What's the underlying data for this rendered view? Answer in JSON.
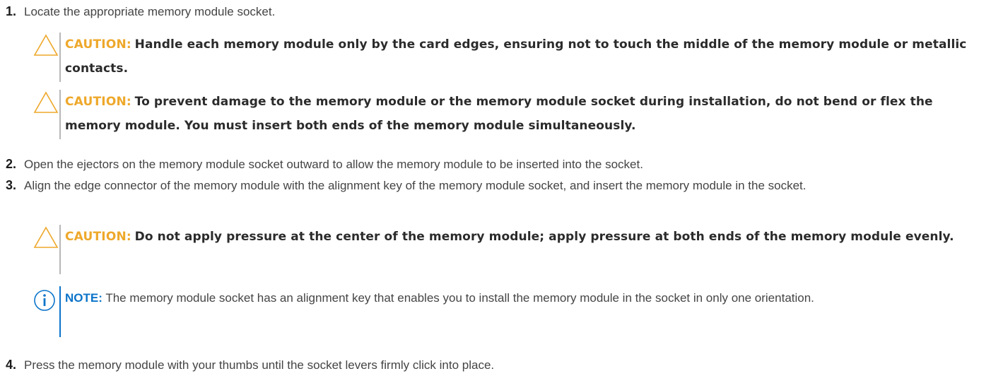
{
  "steps": [
    {
      "number": "1.",
      "text": "Locate the appropriate memory module socket."
    },
    {
      "number": "2.",
      "text": "Open the ejectors on the memory module socket outward to allow the memory module to be inserted into the socket."
    },
    {
      "number": "3.",
      "text": "Align the edge connector of the memory module with the alignment key of the memory module socket, and insert the memory module in the socket."
    },
    {
      "number": "4.",
      "text": "Press the memory module with your thumbs until the socket levers firmly click into place."
    }
  ],
  "cautions": [
    {
      "label": "CAUTION:",
      "text": "Handle each memory module only by the card edges, ensuring not to touch the middle of the memory module or metallic contacts."
    },
    {
      "label": "CAUTION:",
      "text": "To prevent damage to the memory module or the memory module socket during installation, do not bend or flex the memory module. You must insert both ends of the memory module simultaneously."
    },
    {
      "label": "CAUTION:",
      "text": "Do not apply pressure at the center of the memory module; apply pressure at both ends of the memory module evenly."
    }
  ],
  "note": {
    "label": "NOTE:",
    "text": "The memory module socket has an alignment key that enables you to install the memory module in the socket in only one orientation."
  },
  "icons": {
    "caution": "warning-triangle-icon",
    "note": "info-circle-icon"
  },
  "colors": {
    "caution_accent": "#eea82b",
    "note_accent": "#0b74c9"
  }
}
